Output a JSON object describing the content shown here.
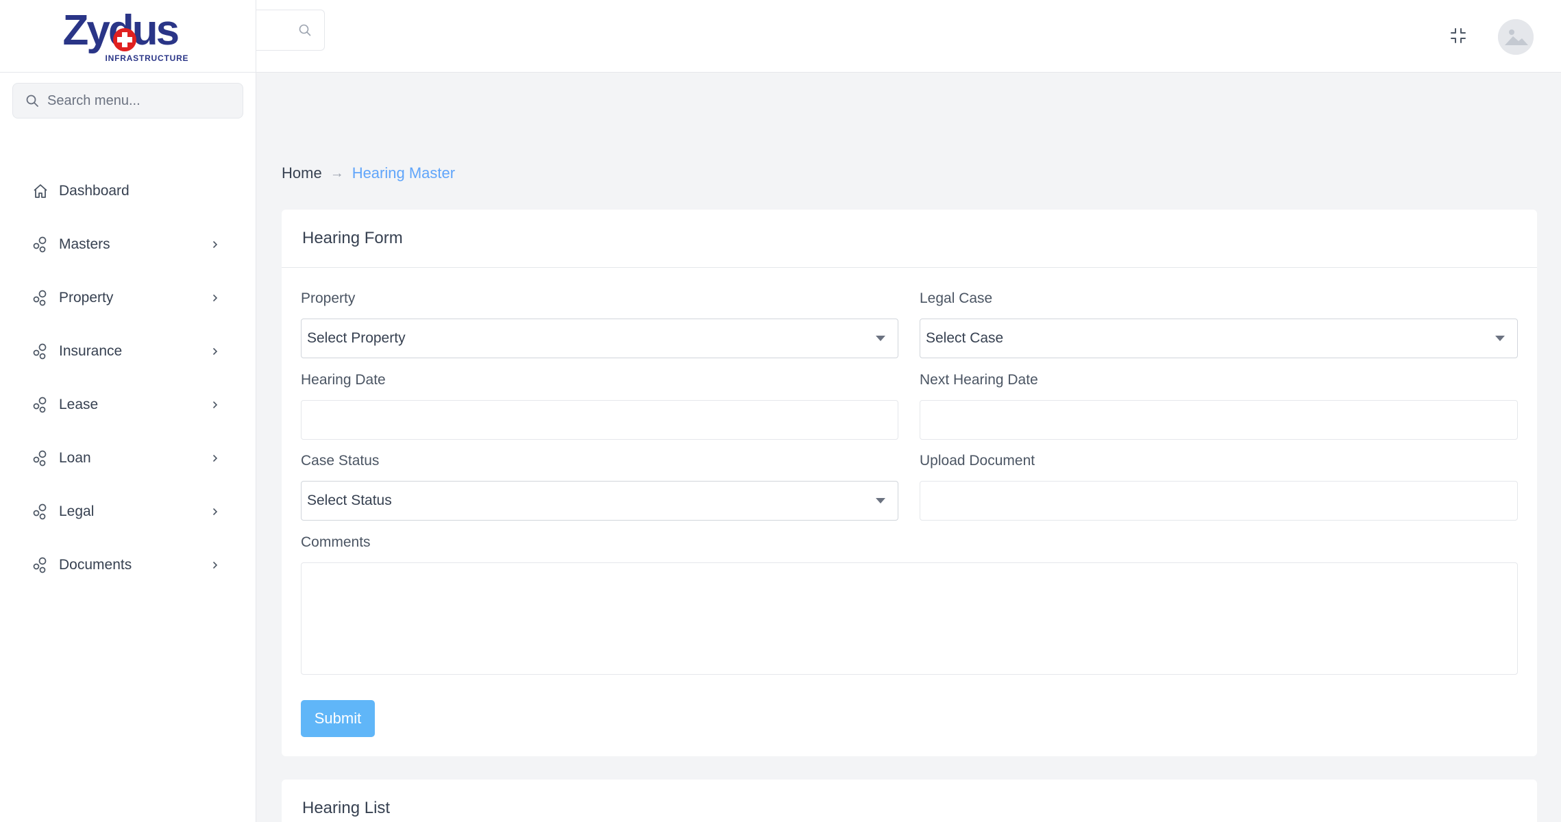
{
  "brand": {
    "name": "Zydus",
    "tagline": "INFRASTRUCTURE",
    "accent": "#2a3587",
    "cross_color": "#e02020"
  },
  "sidebar": {
    "search_placeholder": "Search menu...",
    "items": [
      {
        "label": "Dashboard",
        "icon": "home-icon",
        "has_submenu": false
      },
      {
        "label": "Masters",
        "icon": "nodes-icon",
        "has_submenu": true
      },
      {
        "label": "Property",
        "icon": "nodes-icon",
        "has_submenu": true
      },
      {
        "label": "Insurance",
        "icon": "nodes-icon",
        "has_submenu": true
      },
      {
        "label": "Lease",
        "icon": "nodes-icon",
        "has_submenu": true
      },
      {
        "label": "Loan",
        "icon": "nodes-icon",
        "has_submenu": true
      },
      {
        "label": "Legal",
        "icon": "nodes-icon",
        "has_submenu": true
      },
      {
        "label": "Documents",
        "icon": "nodes-icon",
        "has_submenu": true
      }
    ]
  },
  "topbar": {
    "search_icon": "search-icon",
    "fullscreen_icon": "minimize-icon",
    "avatar_icon": "image-placeholder-icon"
  },
  "breadcrumb": {
    "home": "Home",
    "separator": "→",
    "current": "Hearing Master"
  },
  "form": {
    "title": "Hearing Form",
    "fields": {
      "property": {
        "label": "Property",
        "value": "Select Property"
      },
      "legal_case": {
        "label": "Legal Case",
        "value": "Select Case"
      },
      "hearing_date": {
        "label": "Hearing Date",
        "value": ""
      },
      "next_hearing_date": {
        "label": "Next Hearing Date",
        "value": ""
      },
      "case_status": {
        "label": "Case Status",
        "value": "Select Status"
      },
      "upload_document": {
        "label": "Upload Document",
        "value": ""
      },
      "comments": {
        "label": "Comments",
        "value": ""
      }
    },
    "submit_label": "Submit"
  },
  "list": {
    "title": "Hearing List"
  },
  "colors": {
    "link": "#60a5fa",
    "button": "#60b6f8",
    "background": "#f3f4f6"
  }
}
